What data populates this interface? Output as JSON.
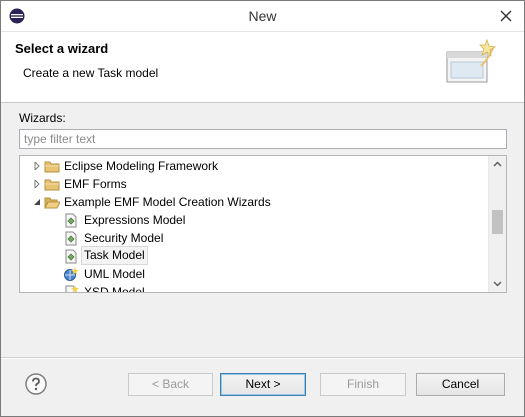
{
  "window": {
    "title": "New"
  },
  "banner": {
    "title": "Select a wizard",
    "description": "Create a new Task model"
  },
  "wizards": {
    "label": "Wizards:",
    "filter_placeholder": "type filter text",
    "tree": [
      {
        "label": "Eclipse Modeling Framework",
        "icon": "folder-icon",
        "expanded": false,
        "level": 0
      },
      {
        "label": "EMF Forms",
        "icon": "folder-icon",
        "expanded": false,
        "level": 0
      },
      {
        "label": "Example EMF Model Creation Wizards",
        "icon": "folder-icon",
        "expanded": true,
        "level": 0
      },
      {
        "label": "Expressions Model",
        "icon": "model-wizard-icon",
        "level": 1
      },
      {
        "label": "Security Model",
        "icon": "model-wizard-icon",
        "level": 1
      },
      {
        "label": "Task Model",
        "icon": "model-wizard-icon",
        "level": 1,
        "selected": true
      },
      {
        "label": "UML Model",
        "icon": "uml-model-icon",
        "level": 1
      },
      {
        "label": "XSD Model",
        "icon": "xsd-model-icon",
        "level": 1
      }
    ]
  },
  "buttons": {
    "back": "< Back",
    "next": "Next >",
    "finish": "Finish",
    "cancel": "Cancel"
  },
  "colors": {
    "folder": "#e8c374",
    "selection_bg": "#f3f3f3",
    "default_button_border": "#3c7fb1"
  }
}
